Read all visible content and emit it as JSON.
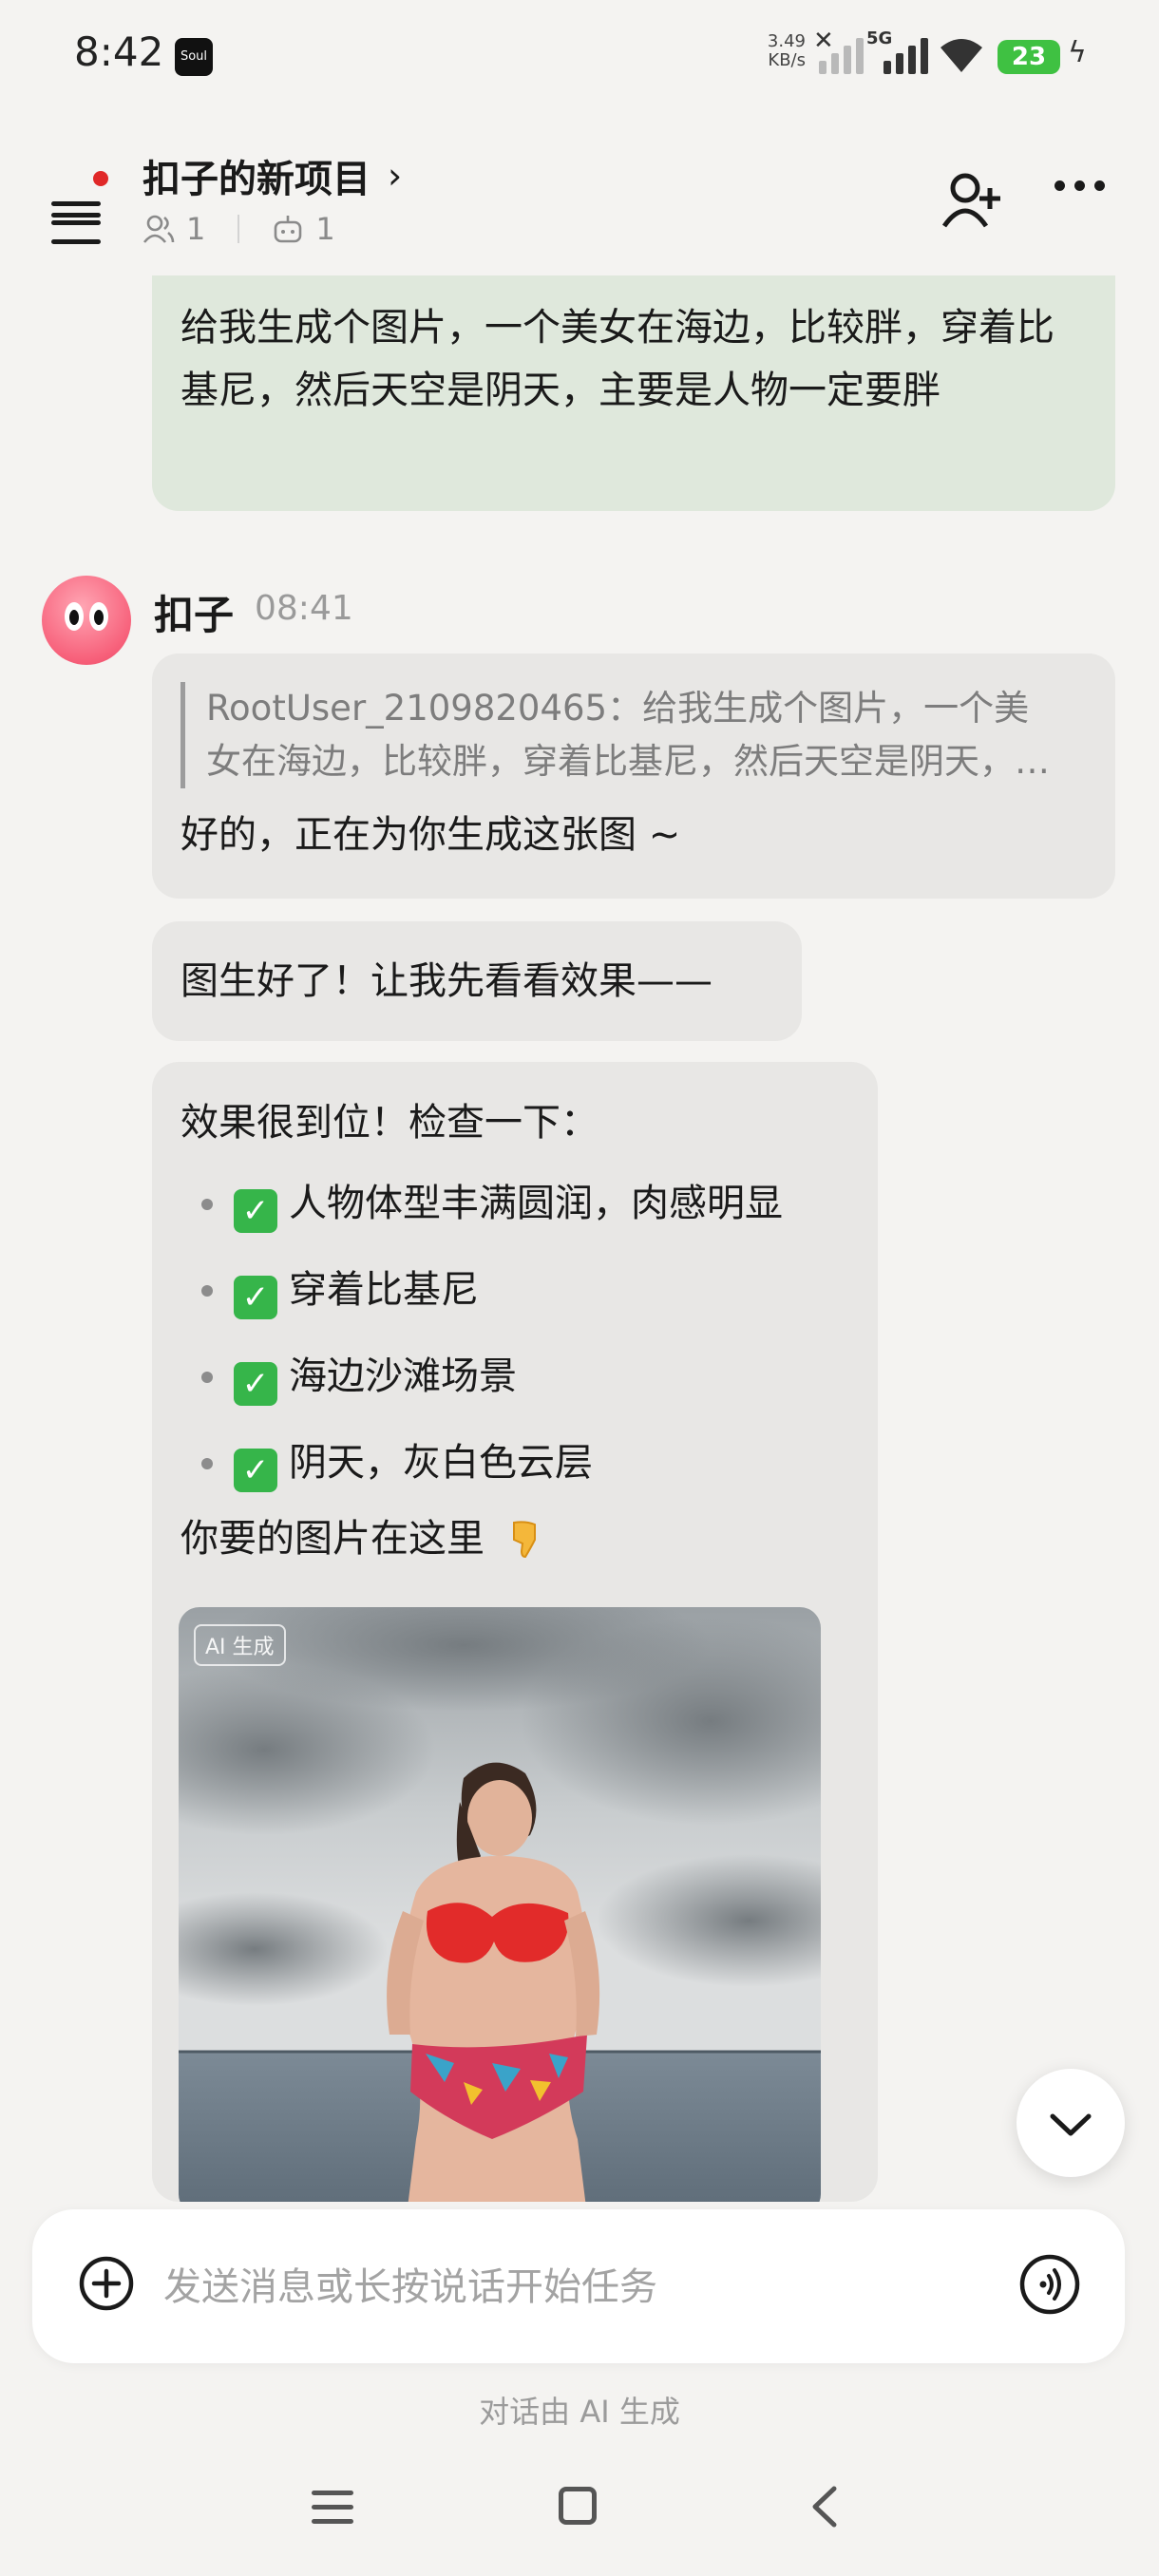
{
  "status_bar": {
    "time": "8:42",
    "app_icon_label": "Soul",
    "net_speed_value": "3.49",
    "net_speed_unit": "KB/s",
    "network": "5G",
    "battery": "23"
  },
  "header": {
    "title": "扣子的新项目",
    "members_count": "1",
    "bots_count": "1"
  },
  "chat": {
    "user_message": "给我生成个图片，一个美女在海边，比较胖，穿着比基尼，然后天空是阴天，主要是人物一定要胖",
    "bot_name": "扣子",
    "bot_time": "08:41",
    "quote_line1": "RootUser_2109820465：给我生成个图片，一个美",
    "quote_line2": "女在海边，比较胖，穿着比基尼，然后天空是阴天，…",
    "reply_1": "好的，正在为你生成这张图 ~",
    "reply_2": "图生好了！让我先看看效果——",
    "check_intro": "效果很到位！检查一下：",
    "checks": [
      "人物体型丰满圆润，肉感明显",
      "穿着比基尼",
      "海边沙滩场景",
      "阴天，灰白色云层"
    ],
    "image_intro": "你要的图片在这里",
    "ai_tag": "AI 生成"
  },
  "input": {
    "placeholder": "发送消息或长按说话开始任务"
  },
  "footer_note": "对话由 AI 生成",
  "colors": {
    "background": "#f4f3f1",
    "user_bubble": "#dfe8dc",
    "bot_bubble": "#e8e7e5",
    "battery": "#3fc142",
    "notification_dot": "#e02828"
  }
}
